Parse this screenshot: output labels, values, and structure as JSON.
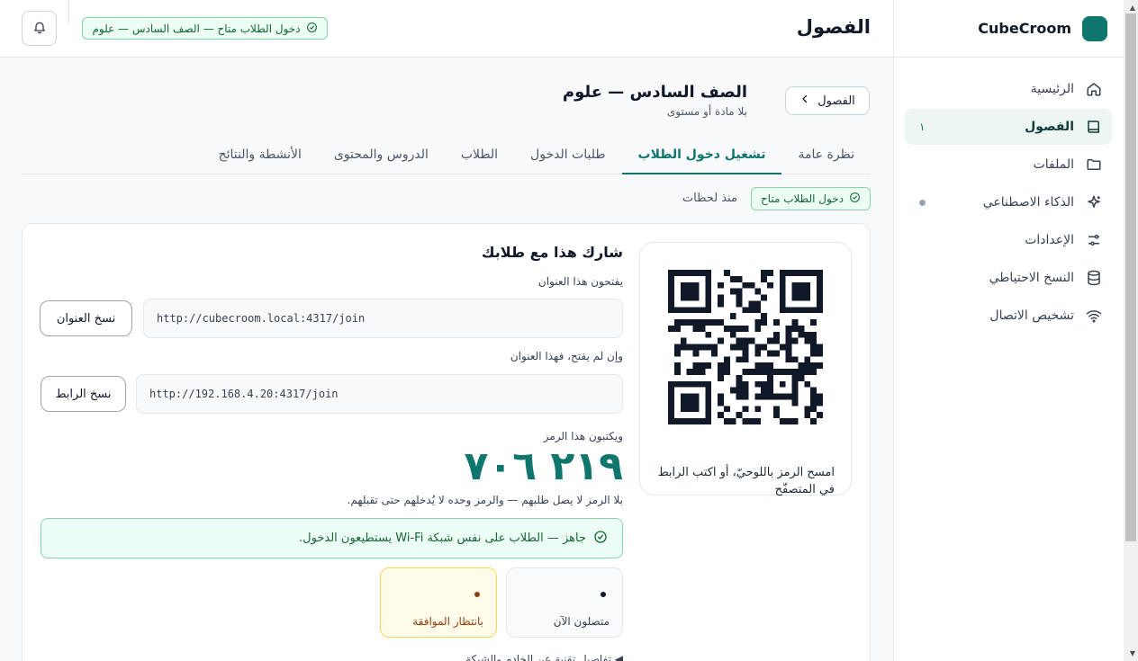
{
  "brand": {
    "name": "CubeCroom"
  },
  "sidebar": {
    "items": [
      {
        "label": "الرئيسية",
        "icon": "home-icon"
      },
      {
        "label": "الفصول",
        "icon": "book-icon",
        "badge": "١",
        "active": true
      },
      {
        "label": "الملفات",
        "icon": "folder-icon"
      },
      {
        "label": "الذكاء الاصطناعي",
        "icon": "sparkle-icon",
        "dot": true
      },
      {
        "label": "الإعدادات",
        "icon": "sliders-icon"
      },
      {
        "label": "النسخ الاحتياطي",
        "icon": "database-icon"
      },
      {
        "label": "تشخيص الاتصال",
        "icon": "wifi-icon"
      }
    ]
  },
  "topbar": {
    "title": "الفصول",
    "pill": "دخول الطلاب متاح — الصف السادس — علوم"
  },
  "header": {
    "class_title": "الصف السادس — علوم",
    "class_sub": "بلا مادة أو مستوى",
    "back_label": "الفصول"
  },
  "tabs": [
    {
      "label": "نظرة عامة"
    },
    {
      "label": "تشغيل دخول الطلاب",
      "active": true
    },
    {
      "label": "طلبات الدخول"
    },
    {
      "label": "الطلاب"
    },
    {
      "label": "الدروس والمحتوى"
    },
    {
      "label": "الأنشطة والنتائج"
    }
  ],
  "status": {
    "pill": "دخول الطلاب متاح",
    "time": "منذ لحظات"
  },
  "share": {
    "title": "شارك هذا مع طلابك",
    "qr_caption": "امسح الرمز باللوحيّ، أو اكتب الرابط في المتصفّح",
    "label1": "يفتحون هذا العنوان",
    "url1": "http://cubecroom.local:4317/join",
    "copy1": "نسخ العنوان",
    "label2": "وإن لم يفتح، فهذا العنوان",
    "url2": "http://192.168.4.20:4317/join",
    "copy2": "نسخ الرابط",
    "label3": "ويكتبون هذا الرمز",
    "code": "٢١٩ ٧٠٦",
    "code_note": "بلا الرمز لا يصل طلبهم — والرمز وحده لا يُدخلهم حتى تقبلهم.",
    "ready": "جاهز — الطلاب على نفس شبكة Wi-Fi يستطيعون الدخول.",
    "stat_now": "متصلون الآن",
    "stat_pending": "بانتظار الموافقة",
    "more_note": "◀ تفاصيل تقنية عن الخادم والشبكة"
  },
  "colors": {
    "accent": "#0f766e",
    "success_bg": "#ecfdf3",
    "pending_bg": "#fffbeb"
  }
}
